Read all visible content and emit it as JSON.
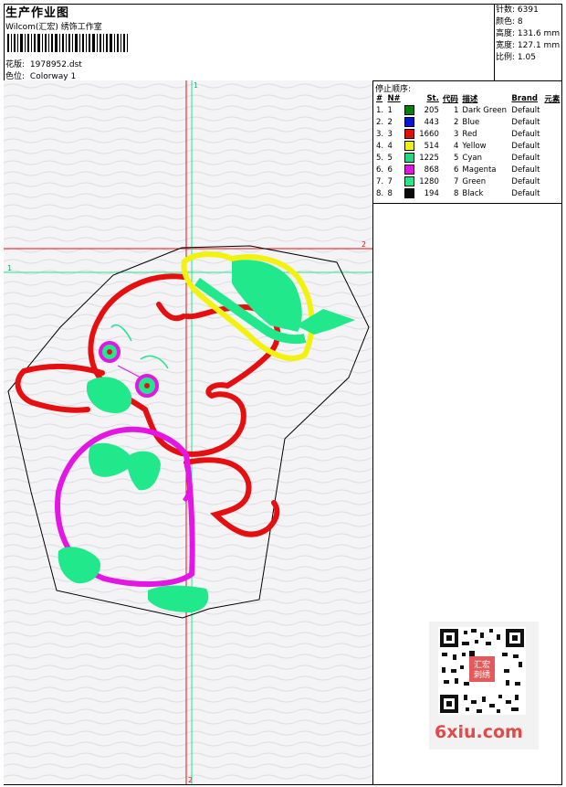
{
  "header": {
    "title": "生产作业图",
    "company": "Wilcom(汇宏) 绣饰工作室",
    "design_label": "花版:",
    "design_value": "1978952.dst",
    "color_label": "色位:",
    "color_value": "Colorway 1"
  },
  "stats": [
    {
      "label": "针数:",
      "value": "6391"
    },
    {
      "label": "颜色:",
      "value": "8"
    },
    {
      "label": "高度:",
      "value": "131.6 mm"
    },
    {
      "label": "宽度:",
      "value": "127.1 mm"
    },
    {
      "label": "比例:",
      "value": "1.05"
    }
  ],
  "sequence": {
    "title": "停止顺序:",
    "headers": [
      "#",
      "N#",
      "St.",
      "代码",
      "描述",
      "Brand",
      "元素"
    ],
    "rows": [
      {
        "idx": "1.",
        "n": "1",
        "color": "#0b7d0b",
        "st": "205",
        "code": "1",
        "desc": "Dark Green",
        "brand": "Default"
      },
      {
        "idx": "2.",
        "n": "2",
        "color": "#0a14d2",
        "st": "443",
        "code": "2",
        "desc": "Blue",
        "brand": "Default"
      },
      {
        "idx": "3.",
        "n": "3",
        "color": "#e00f0f",
        "st": "1660",
        "code": "3",
        "desc": "Red",
        "brand": "Default"
      },
      {
        "idx": "4.",
        "n": "4",
        "color": "#f0f00a",
        "st": "514",
        "code": "4",
        "desc": "Yellow",
        "brand": "Default"
      },
      {
        "idx": "5.",
        "n": "5",
        "color": "#22d98a",
        "st": "1225",
        "code": "5",
        "desc": "Cyan",
        "brand": "Default"
      },
      {
        "idx": "6.",
        "n": "6",
        "color": "#e014e0",
        "st": "868",
        "code": "6",
        "desc": "Magenta",
        "brand": "Default"
      },
      {
        "idx": "7.",
        "n": "7",
        "color": "#22e88c",
        "st": "1280",
        "code": "7",
        "desc": "Green",
        "brand": "Default"
      },
      {
        "idx": "8.",
        "n": "8",
        "color": "#0a0a0a",
        "st": "194",
        "code": "8",
        "desc": "Black",
        "brand": "Default"
      }
    ]
  },
  "canvas": {
    "marker_top": "1",
    "marker_left": "1",
    "marker_right": "2",
    "marker_bottom": "2",
    "colors": {
      "red": "#e50f0f",
      "yellow": "#f2f20c",
      "green": "#22e88c",
      "magenta": "#e316e3",
      "outline": "#000000"
    }
  },
  "watermark": {
    "text": "6xiu.com",
    "stamp": "汇宏刺绣"
  }
}
